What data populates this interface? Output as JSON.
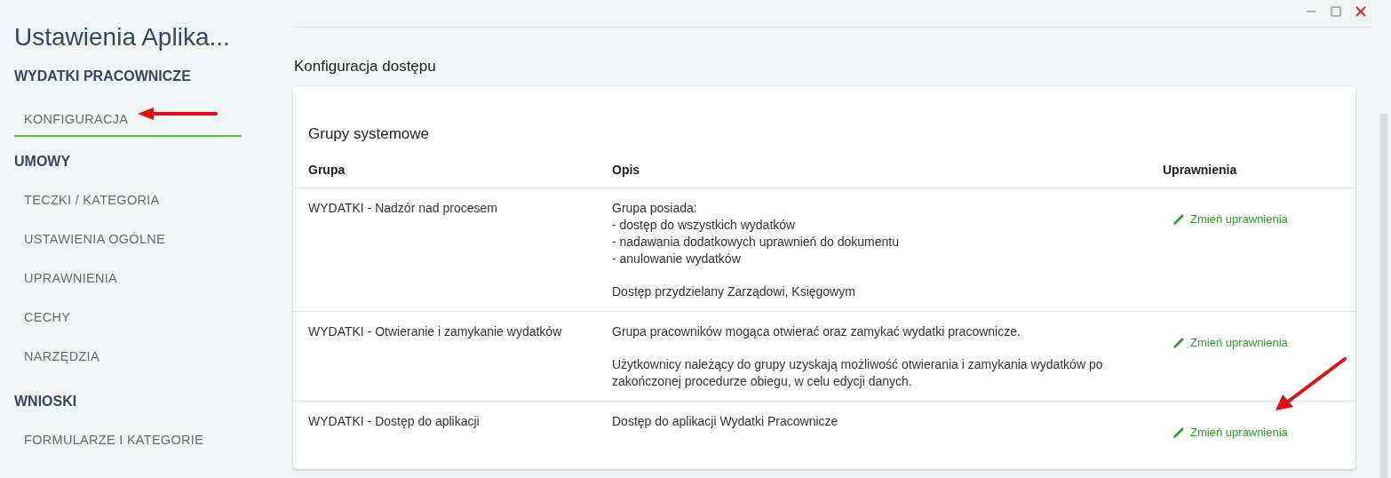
{
  "sidebar": {
    "title": "Ustawienia Aplika...",
    "sections": [
      {
        "label": "WYDATKI PRACOWNICZE",
        "items": [
          {
            "label": "KONFIGURACJA",
            "selected": true
          }
        ]
      },
      {
        "label": "UMOWY",
        "items": [
          {
            "label": "TECZKI / KATEGORIA",
            "selected": false
          },
          {
            "label": "USTAWIENIA OGÓLNE",
            "selected": false
          },
          {
            "label": "UPRAWNIENIA",
            "selected": false
          },
          {
            "label": "CECHY",
            "selected": false
          },
          {
            "label": "NARZĘDZIA",
            "selected": false
          }
        ]
      },
      {
        "label": "WNIOSKI",
        "items": [
          {
            "label": "FORMULARZE I KATEGORIE",
            "selected": false
          }
        ]
      }
    ]
  },
  "main": {
    "heading": "Konfiguracja dostępu",
    "card_title": "Grupy systemowe",
    "table": {
      "columns": [
        "Grupa",
        "Opis",
        "Uprawnienia"
      ],
      "rows": [
        {
          "group": "WYDATKI - Nadzór nad procesem",
          "description": [
            "Grupa posiada:\n- dostęp do wszystkich wydatków\n- nadawania dodatkowych uprawnień do dokumentu\n- anulowanie wydatków",
            "Dostęp przydzielany Zarządowi, Księgowym"
          ],
          "action": "Zmień uprawnienia"
        },
        {
          "group": "WYDATKI - Otwieranie i zamykanie wydatków",
          "description": [
            "Grupa pracowników mogąca otwierać oraz zamykać wydatki pracownicze.",
            "Użytkownicy należący do grupy uzyskają możliwość otwierania i zamykania wydatków po zakończonej procedurze obiegu, w celu edycji danych."
          ],
          "action": "Zmień uprawnienia"
        },
        {
          "group": "WYDATKI - Dostęp do aplikacji",
          "description": [
            "Dostęp do aplikacji Wydatki Pracownicze"
          ],
          "action": "Zmień uprawnienia"
        }
      ]
    }
  }
}
